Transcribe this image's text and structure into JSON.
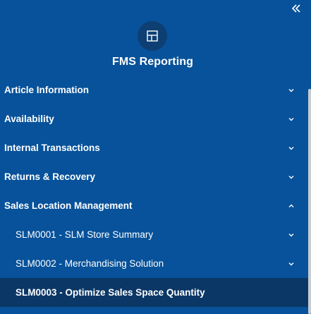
{
  "sidebar": {
    "title": "FMS Reporting",
    "logo_icon": "layout-icon",
    "collapse_icon": "double-chevron-left-icon",
    "items": [
      {
        "label": "Article Information",
        "expanded": false
      },
      {
        "label": "Availability",
        "expanded": false
      },
      {
        "label": "Internal Transactions",
        "expanded": false
      },
      {
        "label": "Returns & Recovery",
        "expanded": false
      },
      {
        "label": "Sales Location Management",
        "expanded": true,
        "children": [
          {
            "label": "SLM0001 - SLM Store Summary",
            "expanded": false
          },
          {
            "label": "SLM0002 - Merchandising Solution",
            "expanded": false
          },
          {
            "label": "SLM0003 - Optimize Sales Space Quantity",
            "active": true
          }
        ]
      }
    ]
  },
  "colors": {
    "sidebar_bg": "#07529a",
    "active_bg": "#0b3766",
    "logo_bg": "#0d3f73",
    "text": "#ffffff"
  }
}
